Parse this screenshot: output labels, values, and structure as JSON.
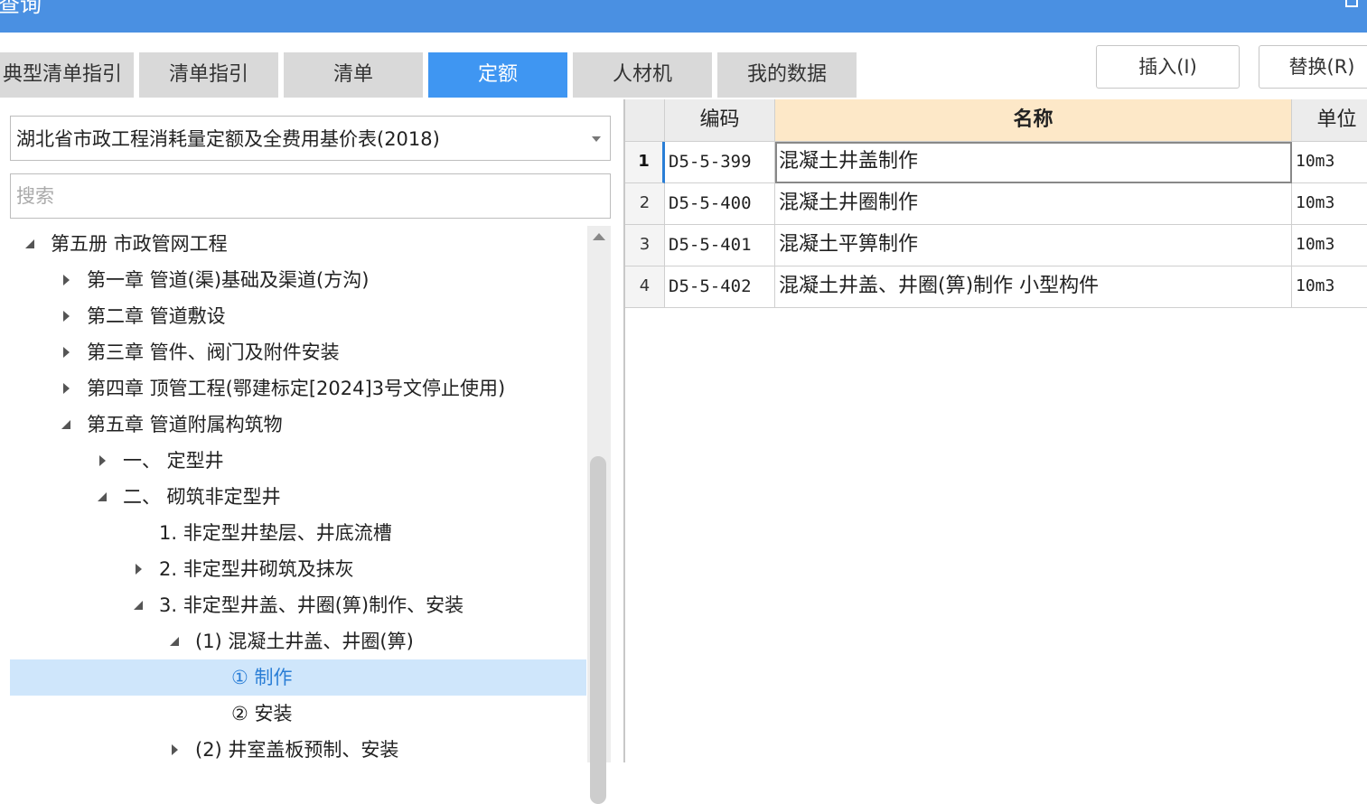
{
  "window": {
    "title": "查询"
  },
  "tabs": [
    {
      "label": "典型清单指引",
      "active": false
    },
    {
      "label": "清单指引",
      "active": false
    },
    {
      "label": "清单",
      "active": false
    },
    {
      "label": "定额",
      "active": true
    },
    {
      "label": "人材机",
      "active": false
    },
    {
      "label": "我的数据",
      "active": false
    }
  ],
  "actions": {
    "insert_label": "插入(I)",
    "replace_label": "替换(R)"
  },
  "library": {
    "selected": "湖北省市政工程消耗量定额及全费用基价表(2018)"
  },
  "search": {
    "placeholder": "搜索",
    "value": ""
  },
  "tree": [
    {
      "label": "第五册 市政管网工程",
      "level": 0,
      "toggle": "expanded"
    },
    {
      "label": "第一章 管道(渠)基础及渠道(方沟)",
      "level": 1,
      "toggle": "collapsed"
    },
    {
      "label": "第二章 管道敷设",
      "level": 1,
      "toggle": "collapsed"
    },
    {
      "label": "第三章 管件、阀门及附件安装",
      "level": 1,
      "toggle": "collapsed"
    },
    {
      "label": "第四章 顶管工程(鄂建标定[2024]3号文停止使用)",
      "level": 1,
      "toggle": "collapsed"
    },
    {
      "label": "第五章 管道附属构筑物",
      "level": 1,
      "toggle": "expanded"
    },
    {
      "label": "一、  定型井",
      "level": 2,
      "toggle": "collapsed"
    },
    {
      "label": "二、  砌筑非定型井",
      "level": 2,
      "toggle": "expanded"
    },
    {
      "label": "1. 非定型井垫层、井底流槽",
      "level": 3,
      "toggle": "none"
    },
    {
      "label": "2. 非定型井砌筑及抹灰",
      "level": 3,
      "toggle": "collapsed"
    },
    {
      "label": "3. 非定型井盖、井圈(箅)制作、安装",
      "level": 3,
      "toggle": "expanded"
    },
    {
      "label": "(1) 混凝土井盖、井圈(箅)",
      "level": 4,
      "toggle": "expanded"
    },
    {
      "label": "① 制作",
      "level": 5,
      "toggle": "none",
      "selected": true
    },
    {
      "label": "② 安装",
      "level": 5,
      "toggle": "none"
    },
    {
      "label": "(2) 井室盖板预制、安装",
      "level": 4,
      "toggle": "collapsed"
    }
  ],
  "table": {
    "headers": {
      "code": "编码",
      "name": "名称",
      "unit": "单位"
    },
    "rows": [
      {
        "num": "1",
        "code": "D5-5-399",
        "name": "混凝土井盖制作",
        "unit": "10m3"
      },
      {
        "num": "2",
        "code": "D5-5-400",
        "name": "混凝土井圈制作",
        "unit": "10m3"
      },
      {
        "num": "3",
        "code": "D5-5-401",
        "name": "混凝土平箅制作",
        "unit": "10m3"
      },
      {
        "num": "4",
        "code": "D5-5-402",
        "name": "混凝土井盖、井圈(箅)制作 小型构件",
        "unit": "10m3"
      }
    ]
  },
  "colors": {
    "titlebar": "#4a90e2",
    "tab_active": "#3f96f2",
    "tab_inactive": "#d9d9d9",
    "selection": "#cfe6fb",
    "sorted_header": "#fde8c8"
  }
}
